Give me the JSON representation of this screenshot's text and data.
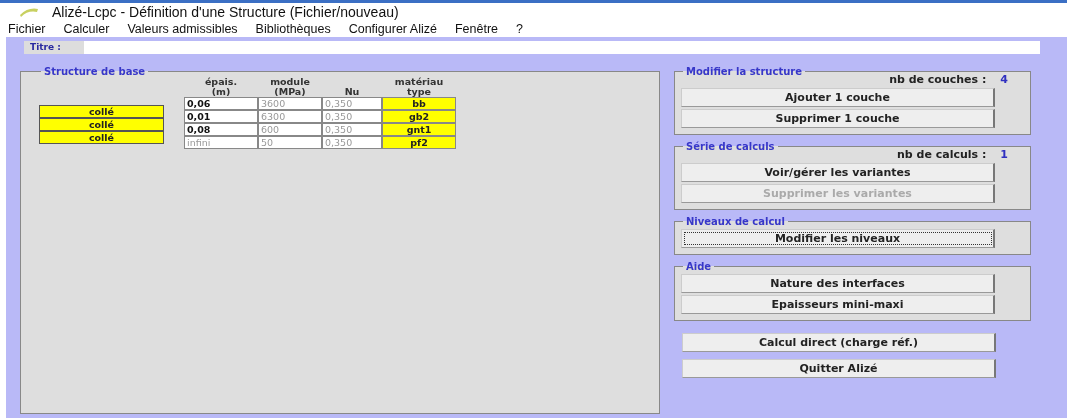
{
  "window": {
    "title": "Alizé-Lcpc - Définition d'une Structure (Fichier/nouveau)"
  },
  "menu": [
    "Fichier",
    "Calculer",
    "Valeurs admissibles",
    "Bibliothèques",
    "Configurer Alizé",
    "Fenêtre",
    "?"
  ],
  "title_field": {
    "label": "Titre :"
  },
  "structure": {
    "title": "Structure de base",
    "columns": [
      "épais.\n(m)",
      "module\n(MPa)",
      "Nu",
      "matériau\ntype"
    ],
    "layers": [
      {
        "thickness": "0,06",
        "thickness_editable": true,
        "modulus": "3600",
        "nu": "0,350",
        "material": "bb"
      },
      {
        "thickness": "0,01",
        "thickness_editable": true,
        "modulus": "6300",
        "nu": "0,350",
        "material": "gb2"
      },
      {
        "thickness": "0,08",
        "thickness_editable": true,
        "modulus": "600",
        "nu": "0,350",
        "material": "gnt1"
      },
      {
        "thickness": "infini",
        "thickness_editable": false,
        "modulus": "50",
        "nu": "0,350",
        "material": "pf2"
      }
    ],
    "interfaces": [
      "collé",
      "collé",
      "collé"
    ]
  },
  "groups": [
    {
      "title": "Modifier la structure",
      "count_label": "nb de couches :",
      "count": "4",
      "buttons": [
        {
          "label": "Ajouter 1 couche",
          "disabled": false,
          "focused": false
        },
        {
          "label": "Supprimer 1 couche",
          "disabled": false,
          "focused": false
        }
      ]
    },
    {
      "title": "Série de calculs",
      "count_label": "nb de calculs :",
      "count": "1",
      "buttons": [
        {
          "label": "Voir/gérer les variantes",
          "disabled": false,
          "focused": false
        },
        {
          "label": "Supprimer les variantes",
          "disabled": true,
          "focused": false
        }
      ]
    },
    {
      "title": "Niveaux de calcul",
      "buttons": [
        {
          "label": "Modifier les niveaux",
          "disabled": false,
          "focused": true
        }
      ]
    },
    {
      "title": "Aide",
      "buttons": [
        {
          "label": "Nature des interfaces",
          "disabled": false,
          "focused": false
        },
        {
          "label": "Epaisseurs mini-maxi",
          "disabled": false,
          "focused": false
        }
      ]
    }
  ],
  "actions": [
    {
      "label": "Calcul direct (charge réf.)",
      "disabled": false,
      "focused": false
    },
    {
      "label": "Quitter Alizé",
      "disabled": false,
      "focused": false
    }
  ]
}
